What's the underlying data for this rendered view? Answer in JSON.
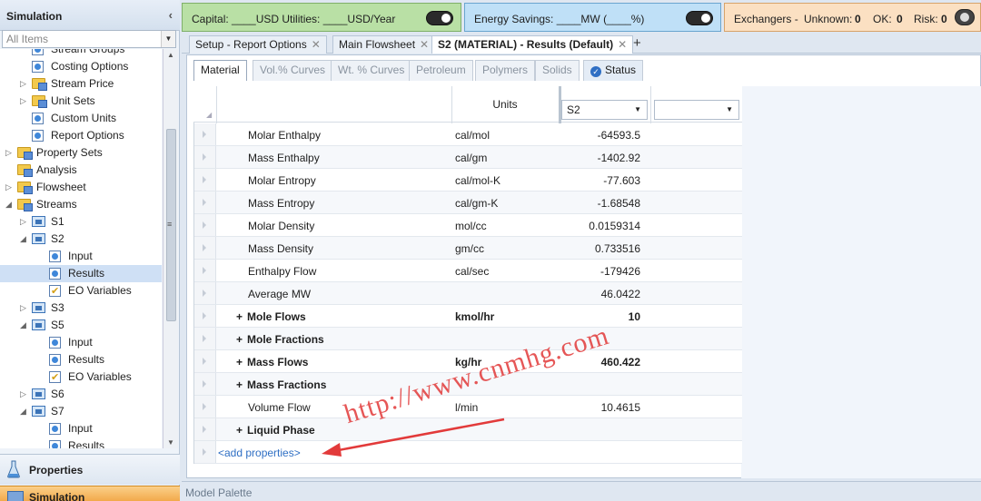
{
  "nav": {
    "title": "Simulation",
    "filter_value": "All Items",
    "tree": [
      {
        "label": "Stream Groups",
        "level": 2,
        "icon": "form-icon"
      },
      {
        "label": "Costing Options",
        "level": 2,
        "icon": "form-icon"
      },
      {
        "label": "Stream Price",
        "level": 2,
        "icon": "folder-icon",
        "expander": "collapsed"
      },
      {
        "label": "Unit Sets",
        "level": 2,
        "icon": "folder-icon",
        "expander": "collapsed"
      },
      {
        "label": "Custom Units",
        "level": 2,
        "icon": "form-icon"
      },
      {
        "label": "Report Options",
        "level": 2,
        "icon": "form-icon"
      },
      {
        "label": "Property Sets",
        "level": 1,
        "icon": "folder-icon",
        "expander": "collapsed"
      },
      {
        "label": "Analysis",
        "level": 1,
        "icon": "folder-icon"
      },
      {
        "label": "Flowsheet",
        "level": 1,
        "icon": "folder-icon",
        "expander": "collapsed"
      },
      {
        "label": "Streams",
        "level": 1,
        "icon": "stream-folder-icon",
        "expander": "expanded"
      },
      {
        "label": "S1",
        "level": 2,
        "icon": "stream-icon",
        "expander": "collapsed"
      },
      {
        "label": "S2",
        "level": 2,
        "icon": "stream-icon",
        "expander": "expanded"
      },
      {
        "label": "Input",
        "level": 3,
        "icon": "form-icon"
      },
      {
        "label": "Results",
        "level": 3,
        "icon": "form-icon",
        "selected": true
      },
      {
        "label": "EO Variables",
        "level": 3,
        "icon": "check-icon"
      },
      {
        "label": "S3",
        "level": 2,
        "icon": "stream-icon",
        "expander": "collapsed"
      },
      {
        "label": "S5",
        "level": 2,
        "icon": "stream-icon",
        "expander": "expanded"
      },
      {
        "label": "Input",
        "level": 3,
        "icon": "form-icon"
      },
      {
        "label": "Results",
        "level": 3,
        "icon": "form-icon"
      },
      {
        "label": "EO Variables",
        "level": 3,
        "icon": "check-icon"
      },
      {
        "label": "S6",
        "level": 2,
        "icon": "stream-icon",
        "expander": "collapsed"
      },
      {
        "label": "S7",
        "level": 2,
        "icon": "stream-icon",
        "expander": "expanded"
      },
      {
        "label": "Input",
        "level": 3,
        "icon": "form-icon"
      },
      {
        "label": "Results",
        "level": 3,
        "icon": "form-icon"
      }
    ],
    "properties_label": "Properties",
    "simulation_label": "Simulation"
  },
  "capital_bar": {
    "text": "Capital: ____USD  Utilities: ____USD/Year"
  },
  "energy_bar": {
    "text": "Energy Savings: ____MW   (____%)"
  },
  "exchangers_bar": {
    "label": "Exchangers -",
    "unknown_label": "Unknown:",
    "unknown_value": "0",
    "ok_label": "OK:",
    "ok_value": "0",
    "risk_label": "Risk:",
    "risk_value": "0"
  },
  "doc_tabs": [
    {
      "label": "Setup - Report Options",
      "active": false
    },
    {
      "label": "Main Flowsheet",
      "active": false
    },
    {
      "label": "S2 (MATERIAL) - Results (Default)",
      "active": true
    }
  ],
  "sub_tabs": [
    {
      "label": "Material",
      "active": true
    },
    {
      "label": "Vol.% Curves"
    },
    {
      "label": "Wt. % Curves"
    },
    {
      "label": "Petroleum"
    },
    {
      "label": "Polymers"
    },
    {
      "label": "Solids"
    },
    {
      "label": "Status",
      "status": true
    }
  ],
  "grid": {
    "units_header": "Units",
    "stream_select": "S2",
    "second_select": "",
    "rows": [
      {
        "property": "Molar Enthalpy",
        "units": "cal/mol",
        "value": "-64593.5"
      },
      {
        "property": "Mass Enthalpy",
        "units": "cal/gm",
        "value": "-1402.92"
      },
      {
        "property": "Molar Entropy",
        "units": "cal/mol-K",
        "value": "-77.603"
      },
      {
        "property": "Mass Entropy",
        "units": "cal/gm-K",
        "value": "-1.68548"
      },
      {
        "property": "Molar Density",
        "units": "mol/cc",
        "value": "0.0159314"
      },
      {
        "property": "Mass Density",
        "units": "gm/cc",
        "value": "0.733516"
      },
      {
        "property": "Enthalpy Flow",
        "units": "cal/sec",
        "value": "-179426"
      },
      {
        "property": "Average MW",
        "units": "",
        "value": "46.0422"
      },
      {
        "property": "Mole Flows",
        "units": "kmol/hr",
        "value": "10",
        "group": true
      },
      {
        "property": "Mole Fractions",
        "units": "",
        "value": "",
        "group": true
      },
      {
        "property": "Mass Flows",
        "units": "kg/hr",
        "value": "460.422",
        "group": true
      },
      {
        "property": "Mass Fractions",
        "units": "",
        "value": "",
        "group": true
      },
      {
        "property": "Volume Flow",
        "units": "l/min",
        "value": "10.4615"
      },
      {
        "property": "Liquid Phase",
        "units": "",
        "value": "",
        "group": true
      }
    ],
    "add_properties": "<add properties>"
  },
  "watermark": "http://www.cnmhg.com",
  "palette_label": "Model Palette",
  "colors": {
    "capital_bg": "#b9e0a5",
    "energy_bg": "#bfe0f7",
    "exchangers_bg": "#fbe0c2",
    "accent": "#2f6fc4",
    "watermark": "#e23a3a"
  }
}
